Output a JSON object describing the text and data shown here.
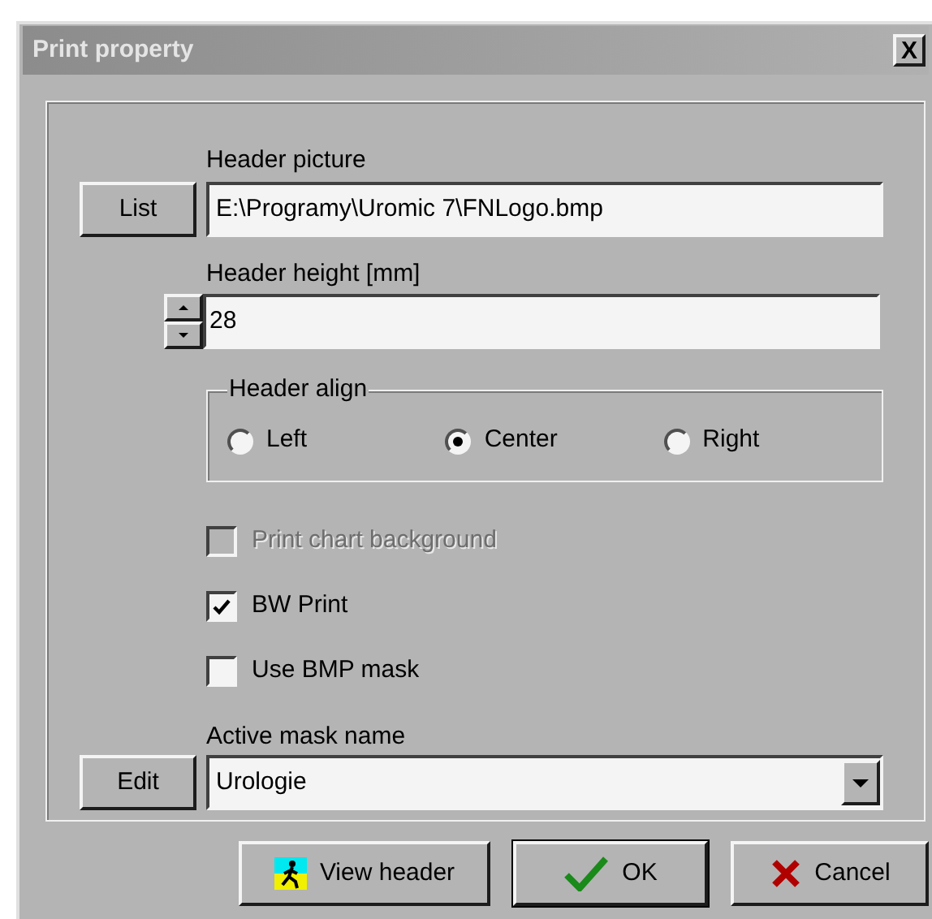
{
  "window": {
    "title": "Print property",
    "close": "X"
  },
  "header_picture": {
    "label": "Header picture",
    "button": "List",
    "value": "E:\\Programy\\Uromic 7\\FNLogo.bmp"
  },
  "header_height": {
    "label": "Header height [mm]",
    "value": "28"
  },
  "header_align": {
    "label": "Header align",
    "options": [
      {
        "label": "Left",
        "selected": false
      },
      {
        "label": "Center",
        "selected": true
      },
      {
        "label": "Right",
        "selected": false
      }
    ]
  },
  "checkboxes": [
    {
      "label": "Print chart background",
      "checked": false,
      "disabled": true
    },
    {
      "label": "BW Print",
      "checked": true,
      "disabled": false
    },
    {
      "label": "Use BMP mask",
      "checked": false,
      "disabled": false
    }
  ],
  "active_mask": {
    "label": "Active mask name",
    "button": "Edit",
    "value": "Urologie"
  },
  "buttons": [
    {
      "label": "View header",
      "kind": "view"
    },
    {
      "label": "OK",
      "kind": "ok"
    },
    {
      "label": "Cancel",
      "kind": "cancel"
    }
  ]
}
